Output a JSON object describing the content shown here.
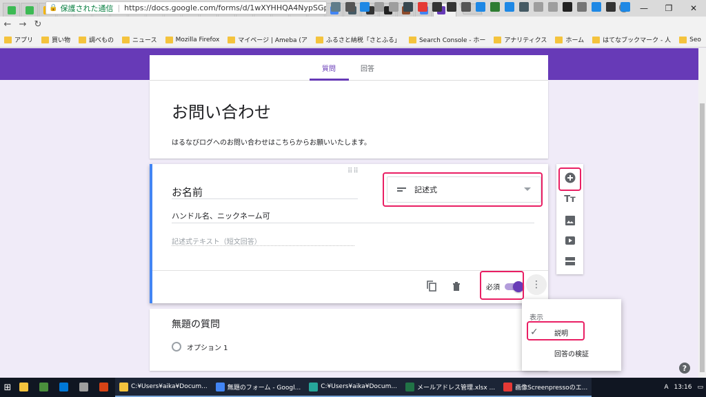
{
  "browser": {
    "tabs": [
      {
        "icon": "hatena-icon",
        "color": "#3cba54"
      },
      {
        "icon": "hatena-icon",
        "color": "#3cba54"
      },
      {
        "icon": "analytics-icon",
        "color": "#f4b400"
      },
      {
        "icon": "analytics-icon",
        "color": "#f4b400"
      },
      {
        "icon": "h-icon",
        "color": "#e91e63"
      },
      {
        "icon": "h-icon",
        "color": "#e91e63"
      },
      {
        "icon": "github-icon",
        "color": "#333333"
      },
      {
        "icon": "info-icon",
        "color": "#555555"
      },
      {
        "icon": "z-icon",
        "color": "#26a69a"
      },
      {
        "icon": "face-icon",
        "color": "#c0392b"
      },
      {
        "icon": "info-icon",
        "color": "#555555"
      },
      {
        "icon": "b-icon",
        "color": "#1e88e5"
      },
      {
        "icon": "google-icon",
        "color": "#4285f4"
      },
      {
        "icon": "l-icon",
        "color": "#e91e63"
      },
      {
        "icon": "square-icon",
        "color": "#555555"
      },
      {
        "icon": "puzzle-icon",
        "color": "#333333"
      },
      {
        "icon": "image-icon",
        "color": "#999999"
      },
      {
        "icon": "screen-icon",
        "color": "#1e88e5"
      },
      {
        "icon": "google-icon",
        "color": "#4285f4"
      },
      {
        "icon": "grid-icon",
        "color": "#455a64"
      },
      {
        "icon": "car-icon",
        "color": "#333333"
      },
      {
        "icon": "qr-icon",
        "color": "#222222"
      },
      {
        "icon": "bag-icon",
        "color": "#8d4b2b"
      },
      {
        "icon": "google-icon",
        "color": "#4285f4"
      }
    ],
    "active_tab": {
      "icon": "forms-icon",
      "color": "#673ab7",
      "close": "×"
    },
    "window_controls": {
      "minimize": "—",
      "restore": "❐",
      "close": "✕"
    },
    "nav": {
      "back": "←",
      "forward": "→",
      "reload": "↻"
    },
    "address": {
      "secure_label": "保護された通信",
      "url": "https://docs.google.com/forms/d/1wXYHHQA4NypSGphy..."
    },
    "bookmarks": [
      {
        "label": "アプリ"
      },
      {
        "label": "買い物"
      },
      {
        "label": "調べもの"
      },
      {
        "label": "ニュース"
      },
      {
        "label": "Mozilla Firefox"
      },
      {
        "label": "マイページ | Ameba (ア"
      },
      {
        "label": "ふるさと納税「さとふる」"
      },
      {
        "label": "Search Console - ホー"
      },
      {
        "label": "アナリティクス"
      },
      {
        "label": "ホーム"
      },
      {
        "label": "はてなブックマーク - 人"
      },
      {
        "label": "Seo"
      }
    ]
  },
  "form": {
    "tabs": {
      "questions": "質問",
      "responses": "回答"
    },
    "title": "お問い合わせ",
    "description": "はるなびログへのお問い合わせはこちらからお願いいたします。",
    "question1": {
      "title": "お名前",
      "description": "ハンドル名、ニックネーム可",
      "placeholder": "記述式テキスト（短文回答）",
      "type": "記述式",
      "required_label": "必須",
      "required": true
    },
    "question2": {
      "title": "無題の質問",
      "option": "オプション 1"
    },
    "menu": {
      "header": "表示",
      "items": [
        "説明",
        "回答の検証"
      ],
      "checked": "説明"
    },
    "accent": "#673ab7",
    "highlight": "#e91e63"
  },
  "taskbar": {
    "items": [
      {
        "label": "C:¥Users¥aika¥Docum...",
        "icon_color": "#f4c33d"
      },
      {
        "label": "無題のフォーム - Googl...",
        "icon_color": "#4285f4"
      },
      {
        "label": "C:¥Users¥aika¥Docum...",
        "icon_color": "#26a69a"
      },
      {
        "label": "メールアドレス管理.xlsx ...",
        "icon_color": "#217346"
      },
      {
        "label": "画像Screenpressoのエ...",
        "icon_color": "#e53935"
      }
    ],
    "tray_ime": "A",
    "time": "13:16"
  }
}
